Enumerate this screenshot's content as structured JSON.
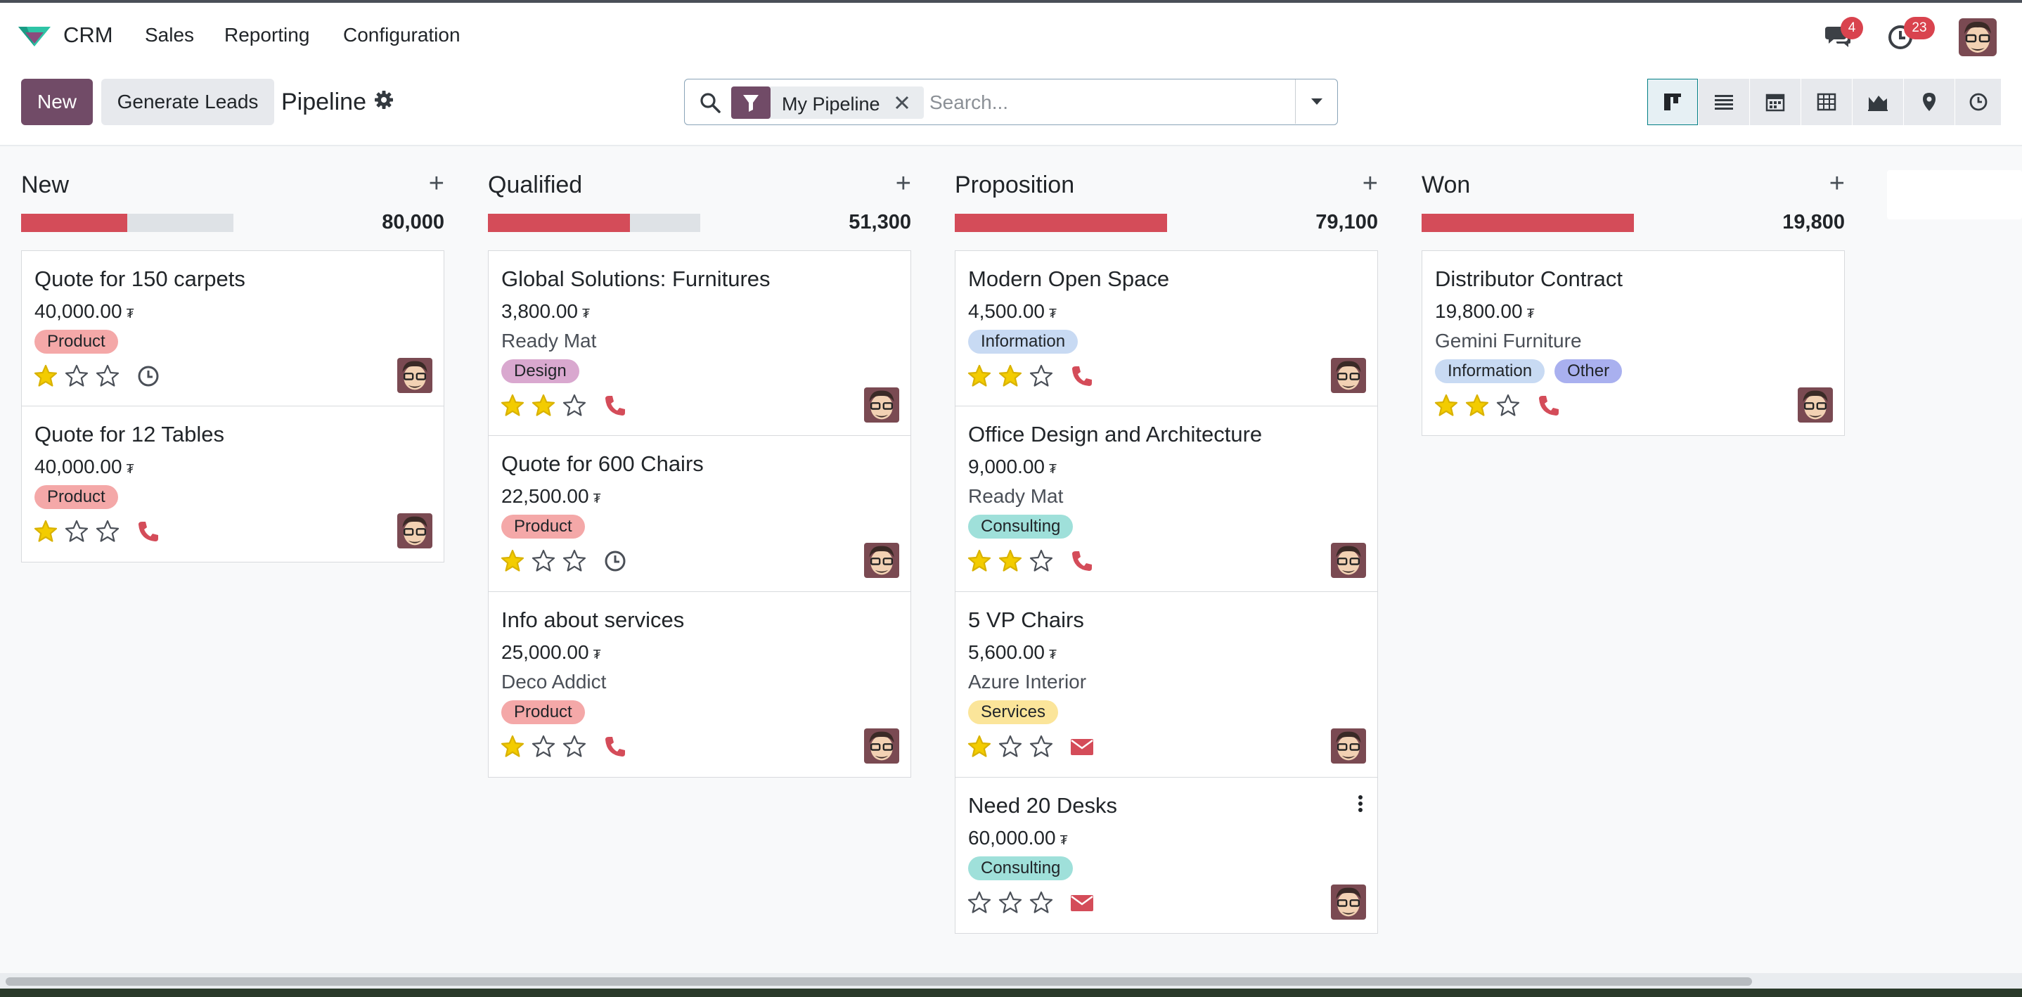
{
  "navbar": {
    "app_name": "CRM",
    "menu": [
      "Sales",
      "Reporting",
      "Configuration"
    ],
    "messages_count": "4",
    "activities_count": "23"
  },
  "control": {
    "new_label": "New",
    "generate_label": "Generate Leads",
    "title": "Pipeline",
    "facet_label": "My Pipeline",
    "search_placeholder": "Search..."
  },
  "colors": {
    "brand": "#714b67",
    "progress_red": "#d44c59",
    "teal": "#017e84"
  },
  "columns": [
    {
      "title": "New",
      "total": "80,000",
      "progress": 0.5,
      "cards": [
        {
          "title": "Quote for 150 carpets",
          "amount": "40,000.00",
          "partner": "",
          "tags": [
            {
              "label": "Product",
              "color": "#f4a8a8"
            }
          ],
          "stars": 1,
          "activity": "clock"
        },
        {
          "title": "Quote for 12 Tables",
          "amount": "40,000.00",
          "partner": "",
          "tags": [
            {
              "label": "Product",
              "color": "#f4a8a8"
            }
          ],
          "stars": 1,
          "activity": "phone"
        }
      ]
    },
    {
      "title": "Qualified",
      "total": "51,300",
      "progress": 0.67,
      "cards": [
        {
          "title": "Global Solutions: Furnitures",
          "amount": "3,800.00",
          "partner": "Ready Mat",
          "tags": [
            {
              "label": "Design",
              "color": "#d9a8cf"
            }
          ],
          "stars": 2,
          "activity": "phone"
        },
        {
          "title": "Quote for 600 Chairs",
          "amount": "22,500.00",
          "partner": "",
          "tags": [
            {
              "label": "Product",
              "color": "#f4a8a8"
            }
          ],
          "stars": 1,
          "activity": "clock"
        },
        {
          "title": "Info about services",
          "amount": "25,000.00",
          "partner": "Deco Addict",
          "tags": [
            {
              "label": "Product",
              "color": "#f4a8a8"
            }
          ],
          "stars": 1,
          "activity": "phone"
        }
      ]
    },
    {
      "title": "Proposition",
      "total": "79,100",
      "progress": 1.0,
      "cards": [
        {
          "title": "Modern Open Space",
          "amount": "4,500.00",
          "partner": "",
          "tags": [
            {
              "label": "Information",
              "color": "#c8daf3"
            }
          ],
          "stars": 2,
          "activity": "phone"
        },
        {
          "title": "Office Design and Architecture",
          "amount": "9,000.00",
          "partner": "Ready Mat",
          "tags": [
            {
              "label": "Consulting",
              "color": "#9fe0da"
            }
          ],
          "stars": 2,
          "activity": "phone"
        },
        {
          "title": "5 VP Chairs",
          "amount": "5,600.00",
          "partner": "Azure Interior",
          "tags": [
            {
              "label": "Services",
              "color": "#fbe59a"
            }
          ],
          "stars": 1,
          "activity": "mail"
        },
        {
          "title": "Need 20 Desks",
          "amount": "60,000.00",
          "partner": "",
          "tags": [
            {
              "label": "Consulting",
              "color": "#9fe0da"
            }
          ],
          "stars": 0,
          "activity": "mail"
        }
      ]
    },
    {
      "title": "Won",
      "total": "19,800",
      "progress": 1.0,
      "cards": [
        {
          "title": "Distributor Contract",
          "amount": "19,800.00",
          "partner": "Gemini Furniture",
          "tags": [
            {
              "label": "Information",
              "color": "#c8daf3"
            },
            {
              "label": "Other",
              "color": "#a9b0ef"
            }
          ],
          "stars": 2,
          "activity": "phone"
        }
      ]
    }
  ]
}
